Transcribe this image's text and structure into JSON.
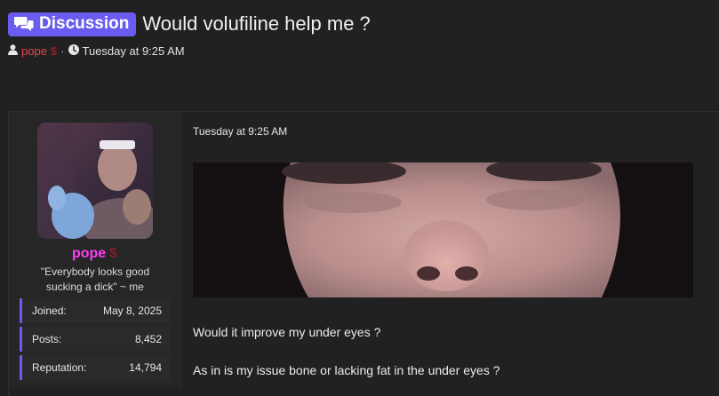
{
  "thread": {
    "prefix": "Discussion",
    "title": "Would volufiline help me ?",
    "author": "pope",
    "author_badge": "$",
    "separator": "·",
    "date": "Tuesday at 9:25 AM"
  },
  "post": {
    "date": "Tuesday at 9:25 AM",
    "user": {
      "name": "pope",
      "badge": "$",
      "title_line1": "\"Everybody looks good",
      "title_line2": "sucking a dick\" ~ me",
      "stats": [
        {
          "label": "Joined:",
          "value": "May 8, 2025"
        },
        {
          "label": "Posts:",
          "value": "8,452"
        },
        {
          "label": "Reputation:",
          "value": "14,794"
        }
      ]
    },
    "body": [
      "Would it improve my under eyes ?",
      "As in is my issue bone or lacking fat in the under eyes ?"
    ]
  },
  "colors": {
    "accent": "#6a5cf0",
    "username": "#ff3df2",
    "author_red": "#e5484d"
  }
}
